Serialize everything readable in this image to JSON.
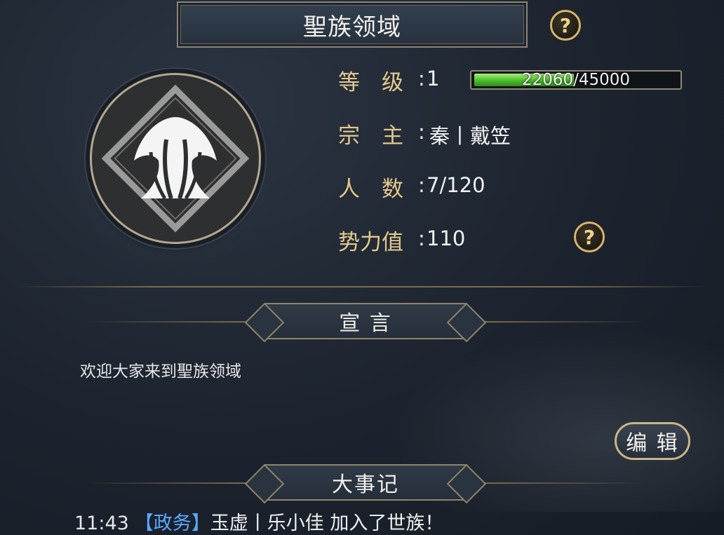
{
  "header": {
    "title": "聖族领域",
    "help": "?"
  },
  "info": {
    "level_label": "等　级",
    "level_value": "1",
    "exp": {
      "current": 22060,
      "max": 45000,
      "text": "22060/45000"
    },
    "leader_label": "宗　主",
    "leader_value": "秦丨戴笠",
    "members_label": "人　数",
    "members_value": "7/120",
    "power_label": "势力值",
    "power_value": "110",
    "power_help": "?"
  },
  "declaration": {
    "title": "宣 言",
    "text": "欢迎大家来到聖族领域",
    "edit_label": "编 辑"
  },
  "events": {
    "title": "大事记",
    "items": [
      {
        "time": "11:43",
        "tag": "【政务】",
        "text": "玉虚丨乐小佳 加入了世族！"
      }
    ]
  },
  "colors": {
    "gold": "#e4c98c",
    "exp_green": "#4bbb2c",
    "tag_blue": "#5aa8ff"
  }
}
